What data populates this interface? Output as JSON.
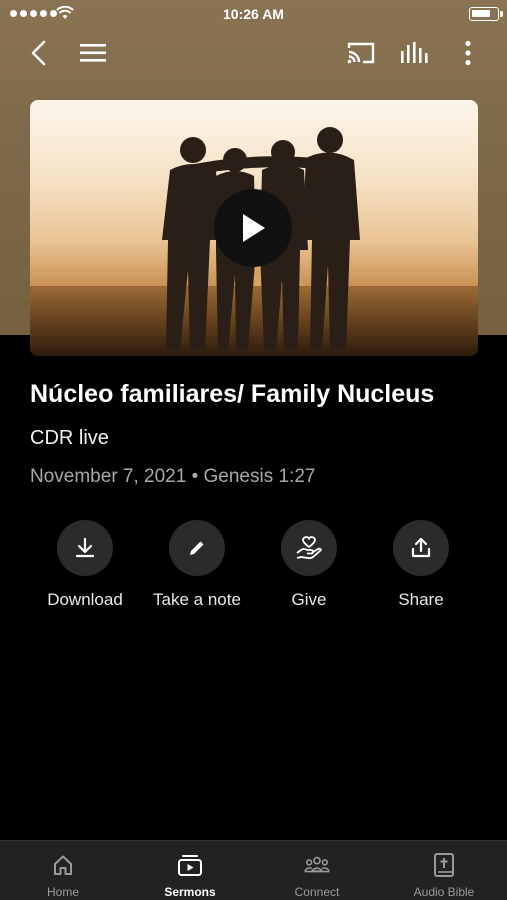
{
  "status_bar": {
    "time": "10:26 AM",
    "battery_level": 0.8
  },
  "nav": {
    "back_icon": "chevron-left-icon",
    "menu_icon": "hamburger-menu-icon",
    "cast_icon": "cast-icon",
    "equalizer_icon": "equalizer-icon",
    "more_icon": "more-vertical-icon"
  },
  "sermon": {
    "title": "Núcleo familiares/ Family Nucleus",
    "channel": "CDR live",
    "meta": "November 7, 2021 • Genesis 1:27"
  },
  "actions": [
    {
      "label": "Download",
      "icon": "download-icon"
    },
    {
      "label": "Take a note",
      "icon": "pencil-icon"
    },
    {
      "label": "Give",
      "icon": "give-hand-heart-icon"
    },
    {
      "label": "Share",
      "icon": "share-icon"
    }
  ],
  "tabs": [
    {
      "label": "Home",
      "icon": "home-icon",
      "active": false
    },
    {
      "label": "Sermons",
      "icon": "sermons-icon",
      "active": true
    },
    {
      "label": "Connect",
      "icon": "people-icon",
      "active": false
    },
    {
      "label": "Audio Bible",
      "icon": "bible-icon",
      "active": false
    }
  ],
  "colors": {
    "header_bg": "#7e6a4a",
    "background": "#000000",
    "tabbar_bg": "#222222",
    "action_circle": "#2b2b2b"
  }
}
